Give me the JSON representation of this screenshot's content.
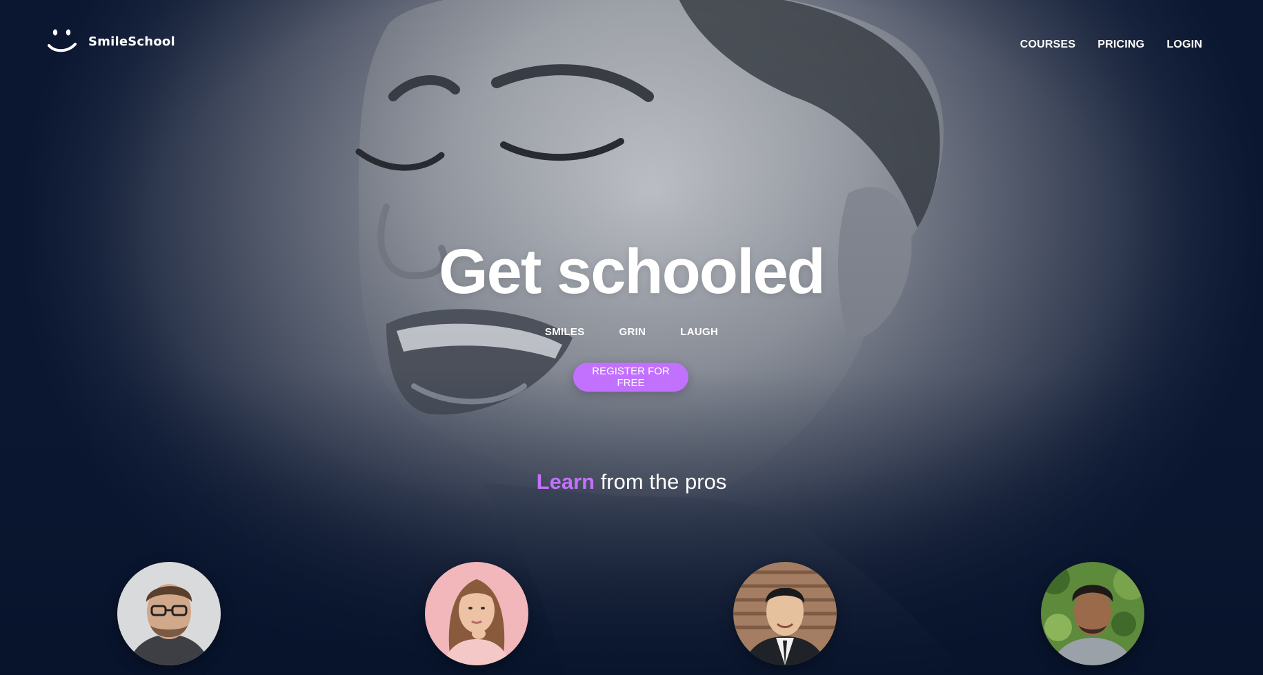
{
  "brand": {
    "name": "SmileSchool",
    "logo_icon": "smiley-face-icon"
  },
  "nav": {
    "items": [
      {
        "label": "COURSES"
      },
      {
        "label": "PRICING"
      },
      {
        "label": "LOGIN"
      }
    ]
  },
  "hero": {
    "title": "Get schooled",
    "tags": [
      "SMILES",
      "GRIN",
      "LAUGH"
    ],
    "cta_label": "REGISTER FOR FREE"
  },
  "section": {
    "heading_accent": "Learn",
    "heading_rest": " from the pros"
  },
  "pros": [
    {
      "photo": "man-with-glasses-portrait"
    },
    {
      "photo": "woman-pink-background-portrait"
    },
    {
      "photo": "man-in-suit-portrait"
    },
    {
      "photo": "man-outdoor-greenery-portrait"
    }
  ],
  "colors": {
    "accent": "#c271ff",
    "text": "#ffffff",
    "backdrop_dark": "#0b1730"
  }
}
